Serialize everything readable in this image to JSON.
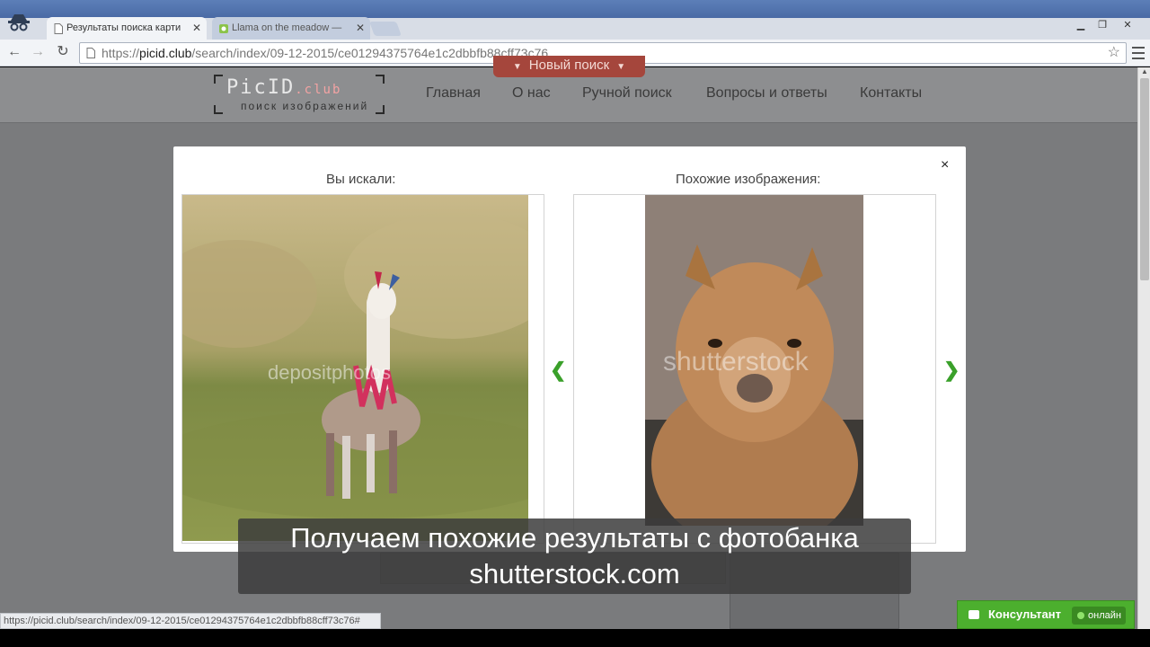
{
  "browser": {
    "tabs": [
      {
        "label": "Результаты поиска карти",
        "active": true
      },
      {
        "label": "Llama on the meadow — ",
        "active": false
      }
    ],
    "url_scheme": "https://",
    "url_domain": "picid.club",
    "url_path": "/search/index/09-12-2015/ce01294375764e1c2dbbfb88cff73c76",
    "status_url": "https://picid.club/search/index/09-12-2015/ce01294375764e1c2dbbfb88cff73c76#"
  },
  "site": {
    "logo_big": "PicID",
    "logo_club": ".club",
    "logo_sub": "поиск изображений",
    "nav": [
      "Главная",
      "О нас",
      "Ручной поиск",
      "Вопросы и ответы",
      "Контакты"
    ],
    "new_search": "Новый поиск"
  },
  "modal": {
    "left_label": "Вы искали:",
    "right_label": "Похожие изображения:",
    "close": "×",
    "left_watermark": "depositphotos",
    "right_watermark": "shutterstock"
  },
  "subtitle": {
    "line1": "Получаем похожие результаты с фотобанка",
    "line2": "shutterstock.com"
  },
  "chat": {
    "label": "Консультант",
    "status": "онлайн"
  },
  "colors": {
    "accent_red": "#a5463c",
    "chat_green": "#4caf2e",
    "arrow_green": "#3aa02a"
  }
}
